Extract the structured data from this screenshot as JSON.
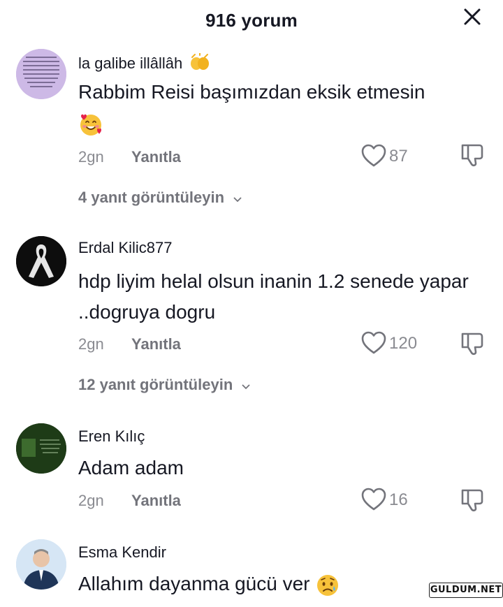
{
  "header": {
    "title": "916 yorum",
    "close_icon": "close-icon"
  },
  "comments": [
    {
      "username": "la galibe illâllâh",
      "username_emoji": "clapping-hands-icon",
      "text": "Rabbim Reisi başımızdan eksik etmesin",
      "text_emoji": "smiling-face-with-hearts-icon",
      "date": "2gn",
      "reply_label": "Yanıtla",
      "likes": "87",
      "view_replies": "4 yanıt görüntüleyin"
    },
    {
      "username": "Erdal Kilic877",
      "text": "hdp liyim helal olsun inanin 1.2 senede yapar ..dogruya dogru",
      "date": "2gn",
      "reply_label": "Yanıtla",
      "likes": "120",
      "view_replies": "12 yanıt görüntüleyin"
    },
    {
      "username": "Eren Kılıç",
      "text": "Adam adam",
      "date": "2gn",
      "reply_label": "Yanıtla",
      "likes": "16"
    },
    {
      "username": "Esma Kendir",
      "text": "Allahım dayanma gücü ver",
      "text_emoji": "sad-but-relieved-face-icon"
    }
  ],
  "watermark": "GULDUM.NET",
  "colors": {
    "text": "#161823",
    "secondary": "#8a8b91",
    "reply": "#73747b",
    "emoji": "#f7c23a"
  }
}
